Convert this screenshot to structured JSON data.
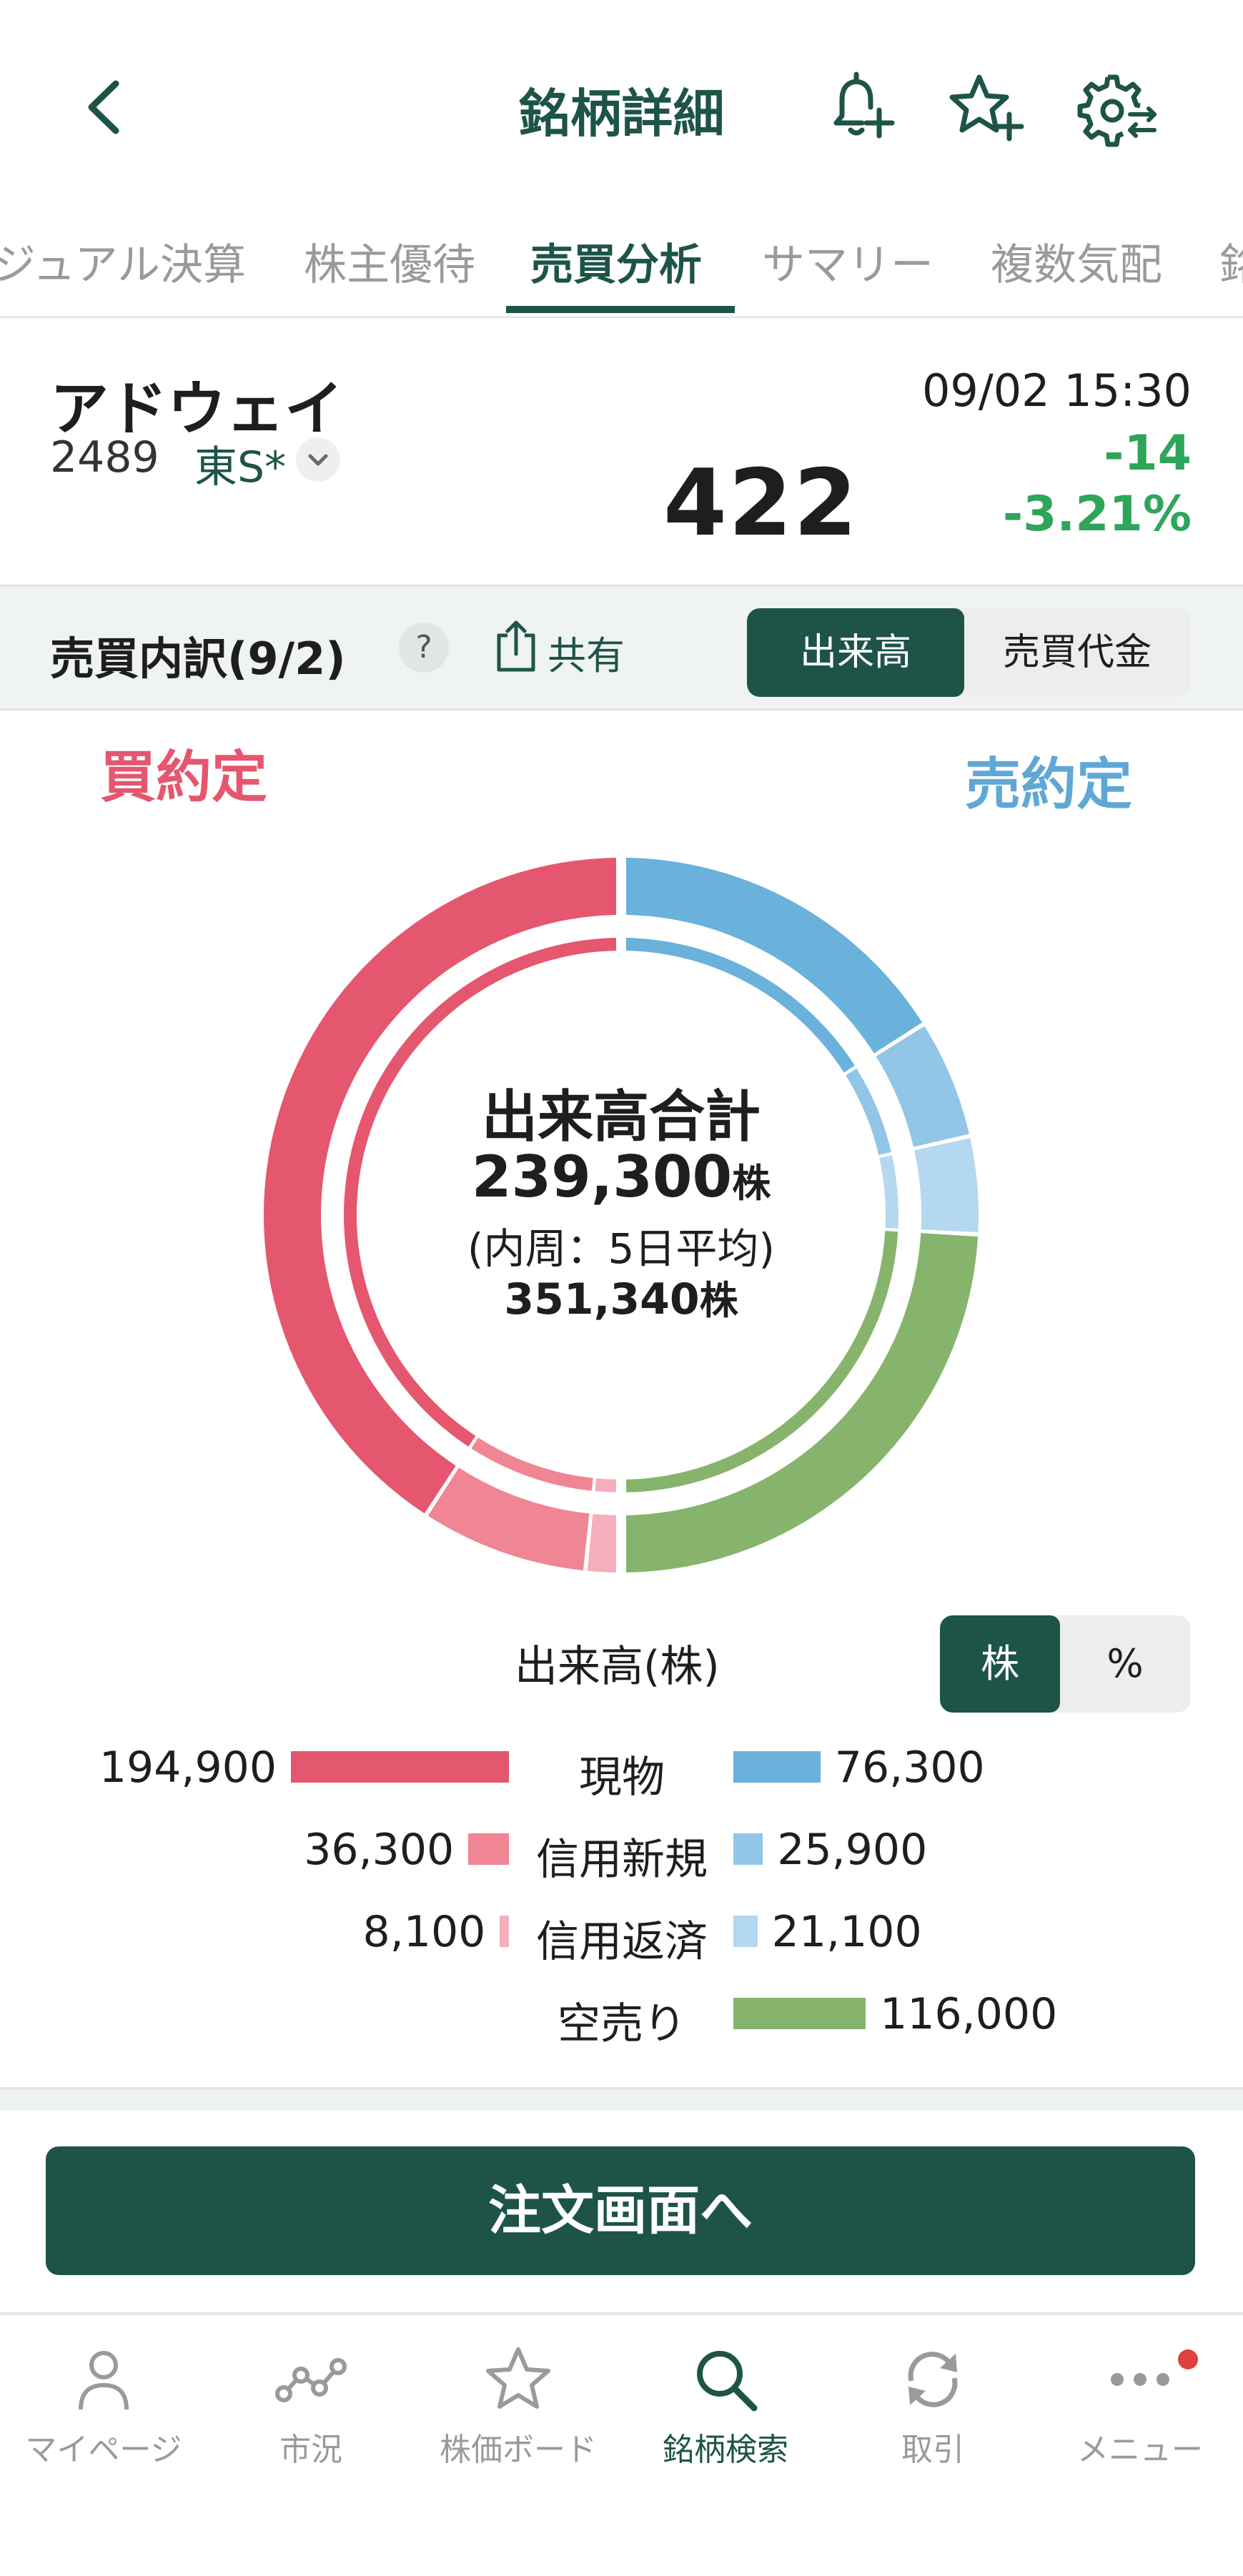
{
  "header": {
    "title": "銘柄詳細",
    "back_icon": "chevron-left-icon",
    "alert_icon": "bell-plus-icon",
    "favorite_icon": "star-plus-icon",
    "settings_icon": "gear-icon"
  },
  "tabs": [
    {
      "label": "ジュアル決算",
      "active": false
    },
    {
      "label": "株主優待",
      "active": false
    },
    {
      "label": "売買分析",
      "active": true
    },
    {
      "label": "サマリー",
      "active": false
    },
    {
      "label": "複数気配",
      "active": false
    },
    {
      "label": "銘",
      "active": false
    }
  ],
  "stock": {
    "name": "アドウェイ",
    "code": "2489",
    "market": "東S*",
    "price": "422",
    "time": "09/02 15:30",
    "change": "-14",
    "change_pct": "-3.21%"
  },
  "section": {
    "title": "売買内訳(9/2)",
    "help": "?",
    "share_label": "共有",
    "toggle": {
      "volume": "出来高",
      "value": "売買代金",
      "selected": "出来高"
    }
  },
  "chart_labels": {
    "buy": "買約定",
    "sell": "売約定"
  },
  "center": {
    "title": "出来高合計",
    "total": "239,300",
    "total_unit": "株",
    "sub": "(内周：5日平均)",
    "avg": "351,340",
    "avg_unit": "株"
  },
  "legend": {
    "title": "出来高(株)",
    "unit_shares": "株",
    "unit_percent": "%",
    "rows": [
      {
        "category": "現物",
        "buy": "194,900",
        "sell": "76,300"
      },
      {
        "category": "信用新規",
        "buy": "36,300",
        "sell": "25,900"
      },
      {
        "category": "信用返済",
        "buy": "8,100",
        "sell": "21,100"
      },
      {
        "category": "空売り",
        "buy": "",
        "sell": "116,000"
      }
    ]
  },
  "order_button": "注文画面へ",
  "nav": [
    {
      "label": "マイページ",
      "icon": "person-icon",
      "active": false
    },
    {
      "label": "市況",
      "icon": "market-chart-icon",
      "active": false
    },
    {
      "label": "株価ボード",
      "icon": "star-icon",
      "active": false
    },
    {
      "label": "銘柄検索",
      "icon": "search-icon",
      "active": true
    },
    {
      "label": "取引",
      "icon": "refresh-icon",
      "active": false
    },
    {
      "label": "メニュー",
      "icon": "more-icon",
      "active": false
    }
  ],
  "colors": {
    "brand": "#1d5447",
    "up_green": "#2fa55a",
    "buy_spot": "#e5566f",
    "buy_margin_new": "#f08594",
    "buy_margin_close": "#f5aebb",
    "sell_spot": "#6ab1dc",
    "sell_margin_new": "#92c6e6",
    "sell_margin_close": "#b3d8ef",
    "short_sell": "#86b46c"
  },
  "chart_data": {
    "type": "pie",
    "title": "出来高合計",
    "categories": [
      "現物",
      "信用新規",
      "信用返済",
      "空売り"
    ],
    "series": [
      {
        "name": "買約定",
        "values": [
          194900,
          36300,
          8100,
          0
        ]
      },
      {
        "name": "売約定",
        "values": [
          76300,
          25900,
          21100,
          116000
        ]
      }
    ],
    "total": 239300,
    "inner_ring": "5日平均",
    "inner_total": 351340
  }
}
